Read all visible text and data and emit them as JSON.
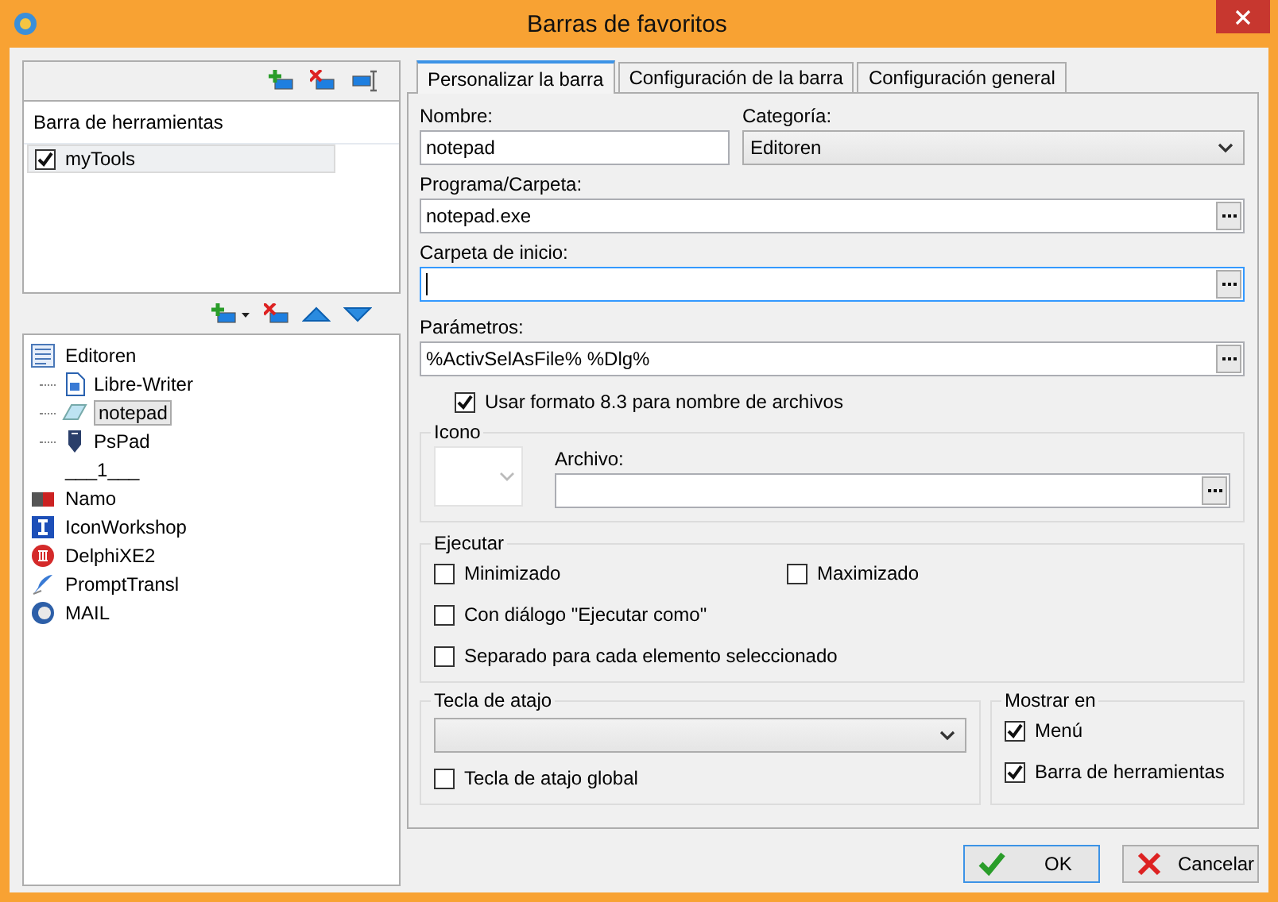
{
  "window": {
    "title": "Barras de favoritos"
  },
  "toolbar_list": {
    "header": "Barra de herramientas",
    "items": [
      {
        "label": "myTools",
        "checked": true,
        "selected": true
      }
    ]
  },
  "tree": {
    "items": [
      {
        "label": "Editoren",
        "kind": "category",
        "selected": false,
        "children": [
          {
            "label": "Libre-Writer",
            "selected": false
          },
          {
            "label": "notepad",
            "selected": true
          },
          {
            "label": "PsPad",
            "selected": false
          }
        ]
      },
      {
        "label": "___1___",
        "kind": "separator",
        "selected": false
      },
      {
        "label": "Namo",
        "kind": "program",
        "selected": false
      },
      {
        "label": "IconWorkshop",
        "kind": "program",
        "selected": false
      },
      {
        "label": "DelphiXE2",
        "kind": "program",
        "selected": false
      },
      {
        "label": "PromptTransl",
        "kind": "program",
        "selected": false
      },
      {
        "label": "MAIL",
        "kind": "program",
        "selected": false
      }
    ]
  },
  "tabs": [
    {
      "label": "Personalizar la barra",
      "selected": true
    },
    {
      "label": "Configuración de la barra",
      "selected": false
    },
    {
      "label": "Configuración general",
      "selected": false
    }
  ],
  "form": {
    "nombre": {
      "label": "Nombre:",
      "value": "notepad"
    },
    "categoria": {
      "label": "Categoría:",
      "value": "Editoren"
    },
    "programa": {
      "label": "Programa/Carpeta:",
      "value": "notepad.exe"
    },
    "carpeta": {
      "label": "Carpeta de inicio:",
      "focused": true
    },
    "parametros": {
      "label": "Parámetros:",
      "value": "%ActivSelAsFile% %Dlg%"
    },
    "short_names": {
      "label": "Usar formato 8.3 para nombre de archivos",
      "checked": true
    }
  },
  "icon_group": {
    "title": "Icono",
    "archivo_label": "Archivo:"
  },
  "ejecutar": {
    "title": "Ejecutar",
    "options": [
      {
        "label": "Minimizado",
        "checked": false
      },
      {
        "label": "Maximizado",
        "checked": false
      },
      {
        "label": "Con diálogo \"Ejecutar como\"",
        "checked": false
      },
      {
        "label": "Separado para cada elemento seleccionado",
        "checked": false
      }
    ]
  },
  "hotkey": {
    "title": "Tecla de atajo",
    "global": {
      "label": "Tecla de atajo global",
      "checked": false
    }
  },
  "mostrar": {
    "title": "Mostrar en",
    "options": [
      {
        "label": "Menú",
        "checked": true
      },
      {
        "label": "Barra de herramientas",
        "checked": true
      }
    ]
  },
  "buttons": [
    {
      "label": "OK",
      "kind": "ok"
    },
    {
      "label": "Cancelar",
      "kind": "cancel"
    }
  ]
}
